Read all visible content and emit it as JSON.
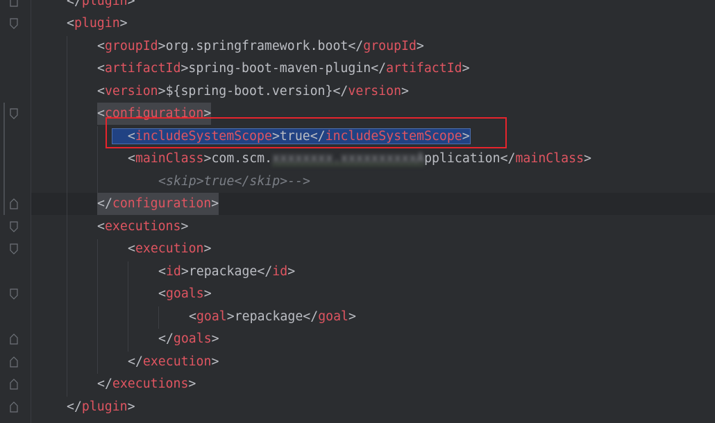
{
  "lines": {
    "l0": {
      "lt": "</",
      "name": "plugin",
      "gt": ">"
    },
    "l1": {
      "lt": "<",
      "name": "plugin",
      "gt": ">"
    },
    "l2": {
      "lt": "<",
      "name": "groupId",
      "gt": ">",
      "text": "org.springframework.boot",
      "clt": "</",
      "cname": "groupId",
      "cgt": ">"
    },
    "l3": {
      "lt": "<",
      "name": "artifactId",
      "gt": ">",
      "text": "spring-boot-maven-plugin",
      "clt": "</",
      "cname": "artifactId",
      "cgt": ">"
    },
    "l4": {
      "lt": "<",
      "name": "version",
      "gt": ">",
      "text": "${spring-boot.version}",
      "clt": "</",
      "cname": "version",
      "cgt": ">"
    },
    "l5": {
      "lt": "<",
      "name": "configuration",
      "gt": ">"
    },
    "l6": {
      "lt": "<",
      "name": "includeSystemScope",
      "gt": ">",
      "text": "true",
      "clt": "</",
      "cname": "includeSystemScope",
      "cgt": ">"
    },
    "l7": {
      "lt": "<",
      "name": "mainClass",
      "gt": ">",
      "text_a": "com.scm.",
      "text_blur": "xxxxxxxx.xxxxxxxxxxA",
      "text_b": "pplication",
      "clt": "</",
      "cname": "mainClass",
      "cgt": ">"
    },
    "l8": {
      "comment": "<skip>true</skip>-->"
    },
    "l9": {
      "lt": "</",
      "name": "configuration",
      "gt": ">"
    },
    "l10": {
      "lt": "<",
      "name": "executions",
      "gt": ">"
    },
    "l11": {
      "lt": "<",
      "name": "execution",
      "gt": ">"
    },
    "l12": {
      "lt": "<",
      "name": "id",
      "gt": ">",
      "text": "repackage",
      "clt": "</",
      "cname": "id",
      "cgt": ">"
    },
    "l13": {
      "lt": "<",
      "name": "goals",
      "gt": ">"
    },
    "l14": {
      "lt": "<",
      "name": "goal",
      "gt": ">",
      "text": "repackage",
      "clt": "</",
      "cname": "goal",
      "cgt": ">"
    },
    "l15": {
      "lt": "</",
      "name": "goals",
      "gt": ">"
    },
    "l16": {
      "lt": "</",
      "name": "execution",
      "gt": ">"
    },
    "l17": {
      "lt": "</",
      "name": "executions",
      "gt": ">"
    },
    "l18": {
      "lt": "</",
      "name": "plugin",
      "gt": ">"
    }
  },
  "colors": {
    "background": "#2b2d30",
    "tag_name": "#e05561",
    "text": "#bcbec4",
    "comment": "#7a7e85",
    "selection": "#214283",
    "annotation_box": "#e8242c"
  }
}
